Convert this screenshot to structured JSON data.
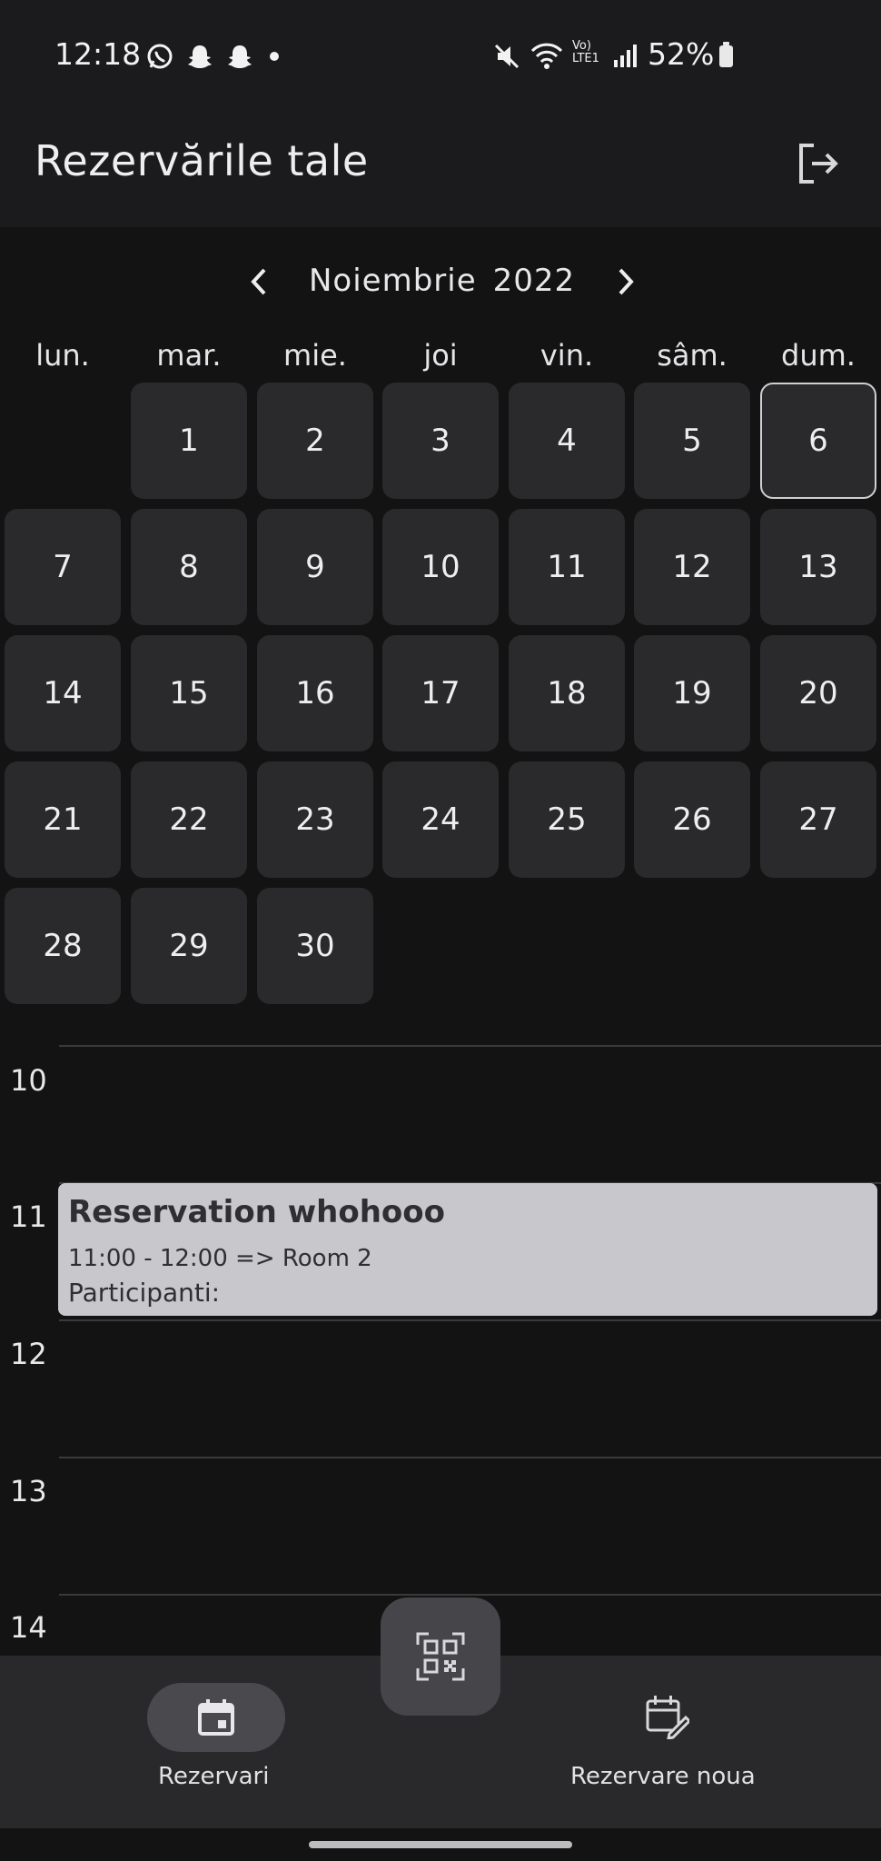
{
  "status_bar": {
    "time": "12:18",
    "battery": "52%",
    "app_icons": [
      "whatsapp-icon",
      "snapchat-icon",
      "snapchat-icon",
      "dot-icon"
    ],
    "system_icons": [
      "mute-icon",
      "wifi-icon",
      "volte-icon",
      "signal-icon",
      "battery-icon"
    ]
  },
  "header": {
    "title": "Rezervările tale",
    "logout_icon": "logout-icon"
  },
  "calendar": {
    "month": "Noiembrie",
    "year": "2022",
    "weekdays": [
      "lun.",
      "mar.",
      "mie.",
      "joi",
      "vin.",
      "sâm.",
      "dum."
    ],
    "days": [
      "1",
      "2",
      "3",
      "4",
      "5",
      "6",
      "7",
      "8",
      "9",
      "10",
      "11",
      "12",
      "13",
      "14",
      "15",
      "16",
      "17",
      "18",
      "19",
      "20",
      "21",
      "22",
      "23",
      "24",
      "25",
      "26",
      "27",
      "28",
      "29",
      "30"
    ],
    "selected_day": "6"
  },
  "agenda": {
    "hours": [
      "10",
      "11",
      "12",
      "13",
      "14"
    ],
    "event": {
      "title": "Reservation whohooo",
      "time": "11:00 - 12:00 => Room 2",
      "participants": "Participanti:"
    }
  },
  "bottom_nav": {
    "items": [
      {
        "label": "Rezervari",
        "icon": "calendar-icon",
        "active": true
      },
      {
        "label": "Rezervare noua",
        "icon": "calendar-edit-icon",
        "active": false
      }
    ],
    "fab_icon": "qr-code-icon"
  },
  "colors": {
    "background": "#131314",
    "surface": "#1b1b1d",
    "day_cell": "#2a2a2c",
    "event_card": "#c8c7cc",
    "bottom_nav": "#29292b"
  }
}
